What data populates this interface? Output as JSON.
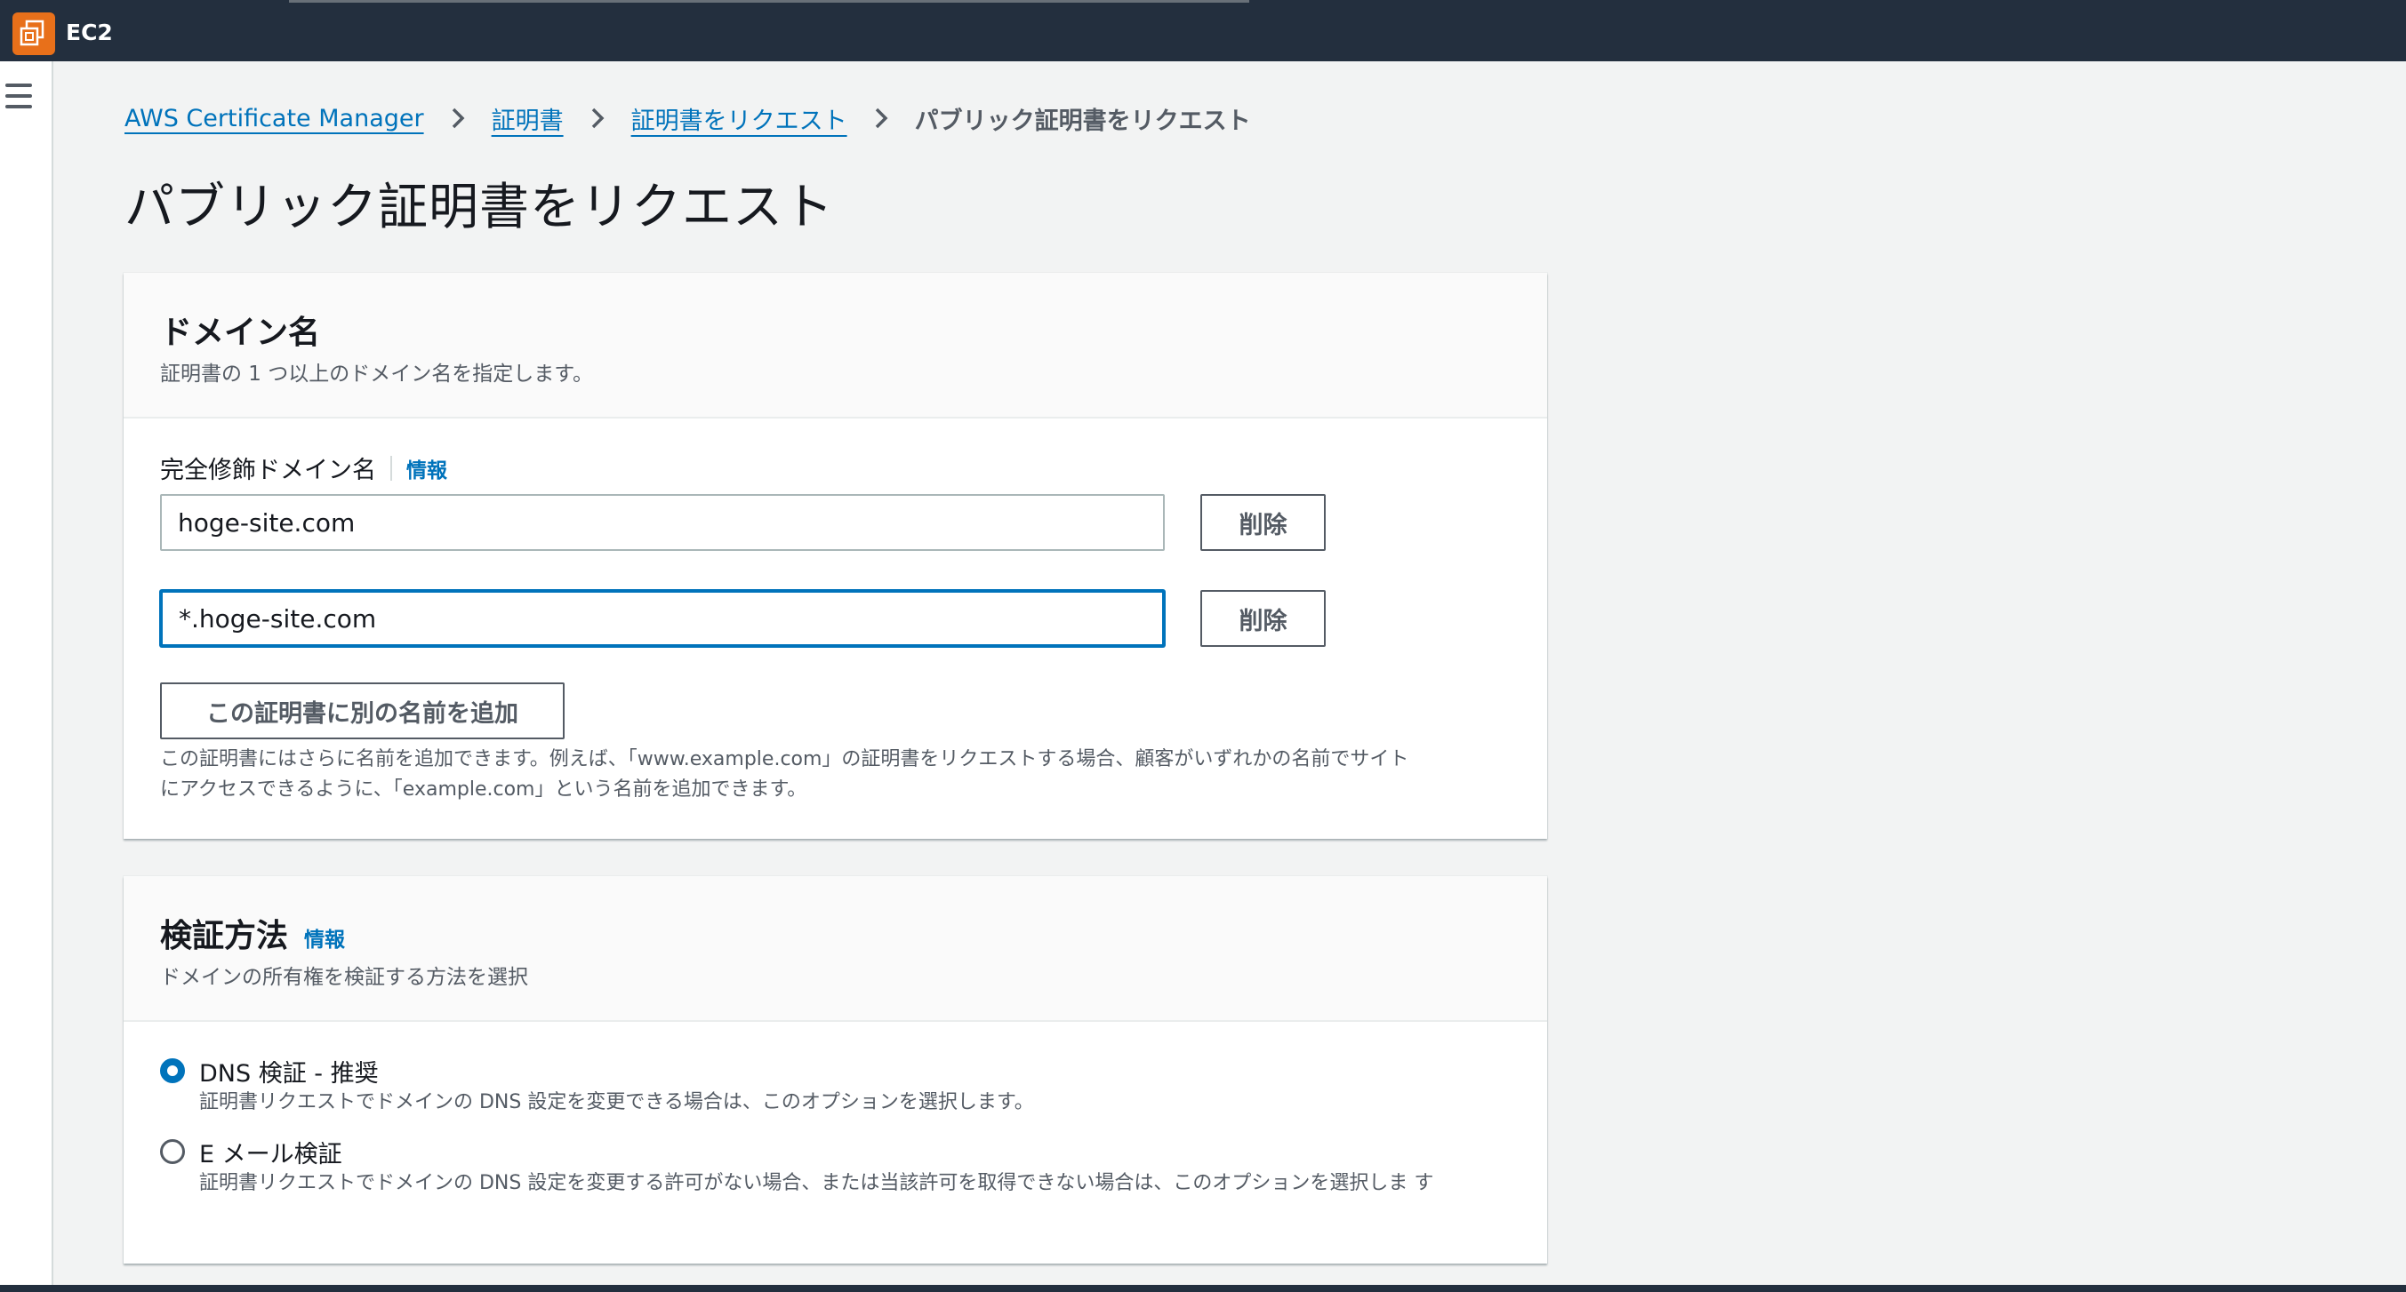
{
  "topbar": {
    "service_name": "EC2",
    "service_icon": "ec2-instances-icon"
  },
  "nav": {
    "menu_icon": "hamburger-menu-icon"
  },
  "breadcrumb": {
    "items": [
      "AWS Certificate Manager",
      "証明書",
      "証明書をリクエスト"
    ],
    "current": "パブリック証明書をリクエスト",
    "separator_icon": "chevron-right-icon"
  },
  "page_title": "パブリック証明書をリクエスト",
  "domain_panel": {
    "title": "ドメイン名",
    "description": "証明書の 1 つ以上のドメイン名を指定します。",
    "field_label": "完全修飾ドメイン名",
    "info_label": "情報",
    "domains": [
      {
        "value": "hoge-site.com",
        "remove_label": "削除"
      },
      {
        "value": "*.hoge-site.com",
        "remove_label": "削除"
      }
    ],
    "add_button_label": "この証明書に別の名前を追加",
    "help_line1": "この証明書にはさらに名前を追加できます。例えば、「www.example.com」の証明書をリクエストする場合、顧客がいずれかの名前でサイト",
    "help_line2": "にアクセスできるように、「example.com」という名前を追加できます。"
  },
  "validation_panel": {
    "title": "検証方法",
    "info_label": "情報",
    "description": "ドメインの所有権を検証する方法を選択",
    "options": [
      {
        "label": "DNS 検証 - 推奨",
        "description": "証明書リクエストでドメインの DNS 設定を変更できる場合は、このオプションを選択します。",
        "selected": true
      },
      {
        "label": "E メール検証",
        "description": "証明書リクエストでドメインの DNS 設定を変更する許可がない場合、または当該許可を取得できない場合は、このオプションを選択しま す",
        "selected": false
      }
    ]
  },
  "colors": {
    "topbar": "#232f3e",
    "accent": "#0073bb",
    "service_icon_bg": "#e8701a"
  }
}
